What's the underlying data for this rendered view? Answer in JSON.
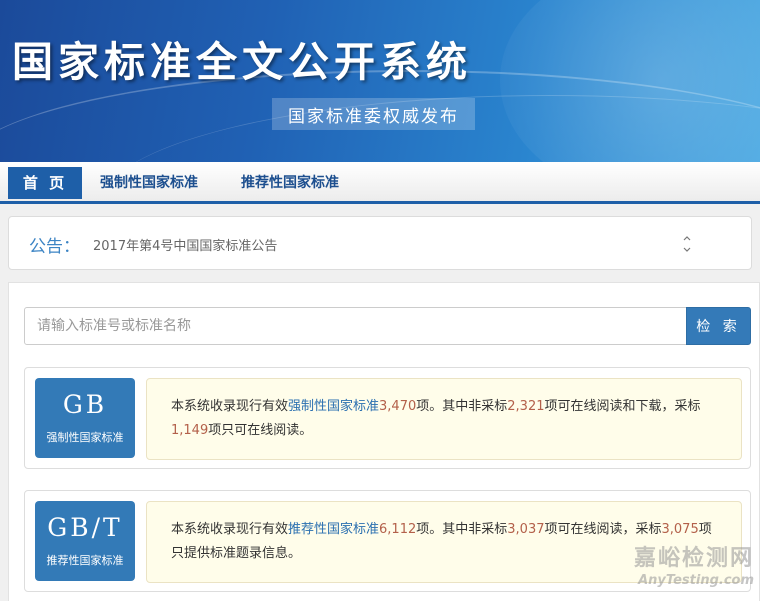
{
  "banner": {
    "title": "国家标准全文公开系统",
    "subtitle": "国家标准委权威发布"
  },
  "nav": {
    "items": [
      {
        "label": "首 页",
        "active": true
      },
      {
        "label": "强制性国家标准",
        "active": false
      },
      {
        "label": "推荐性国家标准",
        "active": false
      }
    ]
  },
  "notice": {
    "label": "公告：",
    "text": "2017年第4号中国国家标准公告",
    "arrows_icon": "up-down-chevron-icon"
  },
  "search": {
    "placeholder": "请输入标准号或标准名称",
    "value": "",
    "button_label": "检 索"
  },
  "cards": [
    {
      "code": "GB",
      "label": "强制性国家标准",
      "desc": {
        "prefix": "本系统收录现行有效",
        "link": "强制性国家标准",
        "total": "3,470",
        "mid1": "项。其中非采标",
        "count1": "2,321",
        "mid2": "项可在线阅读和下载，采标",
        "count2": "1,149",
        "suffix": "项只可在线阅读。"
      }
    },
    {
      "code": "GB/T",
      "label": "推荐性国家标准",
      "desc": {
        "prefix": "本系统收录现行有效",
        "link": "推荐性国家标准",
        "total": "6,112",
        "mid1": "项。其中非采标",
        "count1": "3,037",
        "mid2": "项可在线阅读，采标",
        "count2": "3,075",
        "suffix": "项只提供标准题录信息。"
      }
    }
  ],
  "watermark": {
    "cn": "嘉峪检测网",
    "en": "AnyTesting.com"
  },
  "colors": {
    "primary": "#337ab7",
    "nav_text": "#1d4f8f",
    "notice_label": "#3c84c4",
    "number": "#b3604a",
    "desc_bg": "#fffdea"
  }
}
